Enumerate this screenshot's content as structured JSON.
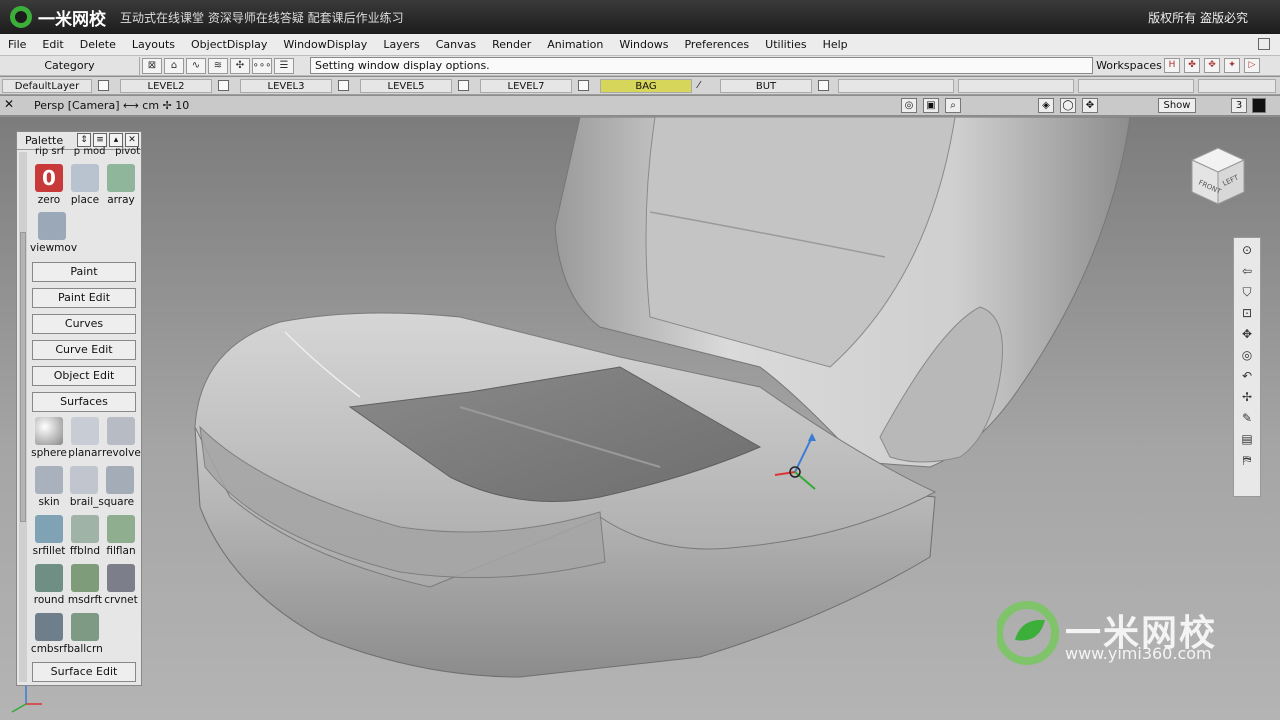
{
  "banner": {
    "brand": "一米网校",
    "slogan": "互动式在线课堂  资深导师在线答疑  配套课后作业练习",
    "rights": "版权所有  盗版必究"
  },
  "menu": [
    "File",
    "Edit",
    "Delete",
    "Layouts",
    "ObjectDisplay",
    "WindowDisplay",
    "Layers",
    "Canvas",
    "Render",
    "Animation",
    "Windows",
    "Preferences",
    "Utilities",
    "Help"
  ],
  "toolbar": {
    "category": "Category",
    "hint": "Setting window display options.",
    "workspaces": "Workspaces"
  },
  "layers": [
    {
      "label": "DefaultLayer",
      "selected": false
    },
    {
      "label": "LEVEL2",
      "selected": false
    },
    {
      "label": "LEVEL3",
      "selected": false
    },
    {
      "label": "LEVEL5",
      "selected": false
    },
    {
      "label": "LEVEL7",
      "selected": false
    },
    {
      "label": "BAG",
      "selected": true
    },
    {
      "label": "BUT",
      "selected": false
    }
  ],
  "viewport": {
    "camera": "Persp [Camera]",
    "units": "cm",
    "grid_value": "10",
    "show_label": "Show",
    "pane_number": "3"
  },
  "palette": {
    "title": "Palette",
    "partial_labels": "rip srf   p mod   pivot",
    "tools_top": [
      "zero",
      "place",
      "array"
    ],
    "viewmove": "viewmov",
    "sections": [
      "Paint",
      "Paint Edit",
      "Curves",
      "Curve Edit",
      "Object Edit",
      "Surfaces"
    ],
    "surface_tools": [
      "sphere",
      "planar",
      "revolve",
      "skin",
      "brail_square",
      "srfillet",
      "ffblnd",
      "filflan",
      "round",
      "msdrft",
      "crvnet",
      "cmbsrf",
      "ballcrn"
    ],
    "bottom_section": "Surface Edit"
  },
  "viewcube": {
    "front": "FRONT",
    "left": "LEFT"
  },
  "watermark": {
    "name": "一米网校",
    "url": "www.yimi360.com"
  },
  "colors": {
    "layer_selected": "#d6d65a",
    "brand_green": "#3cae3a"
  }
}
